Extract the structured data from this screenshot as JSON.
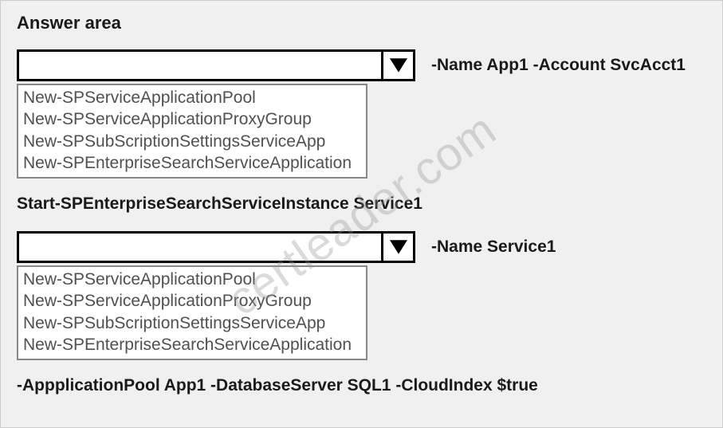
{
  "title": "Answer area",
  "dropdown1": {
    "selected": "",
    "suffix": "-Name App1 -Account SvcAcct1",
    "options": [
      "New-SPServiceApplicationPool",
      "New-SPServiceApplicationProxyGroup",
      "New-SPSubScriptionSettingsServiceApp",
      "New-SPEnterpriseSearchServiceApplication"
    ]
  },
  "middle_command": "Start-SPEnterpriseSearchServiceInstance Service1",
  "dropdown2": {
    "selected": "",
    "suffix": "-Name Service1",
    "options": [
      "New-SPServiceApplicationPool",
      "New-SPServiceApplicationProxyGroup",
      "New-SPSubScriptionSettingsServiceApp",
      "New-SPEnterpriseSearchServiceApplication"
    ]
  },
  "bottom_command": "-AppplicationPool App1 -DatabaseServer SQL1 -CloudIndex $true",
  "watermark": "certleader.com"
}
